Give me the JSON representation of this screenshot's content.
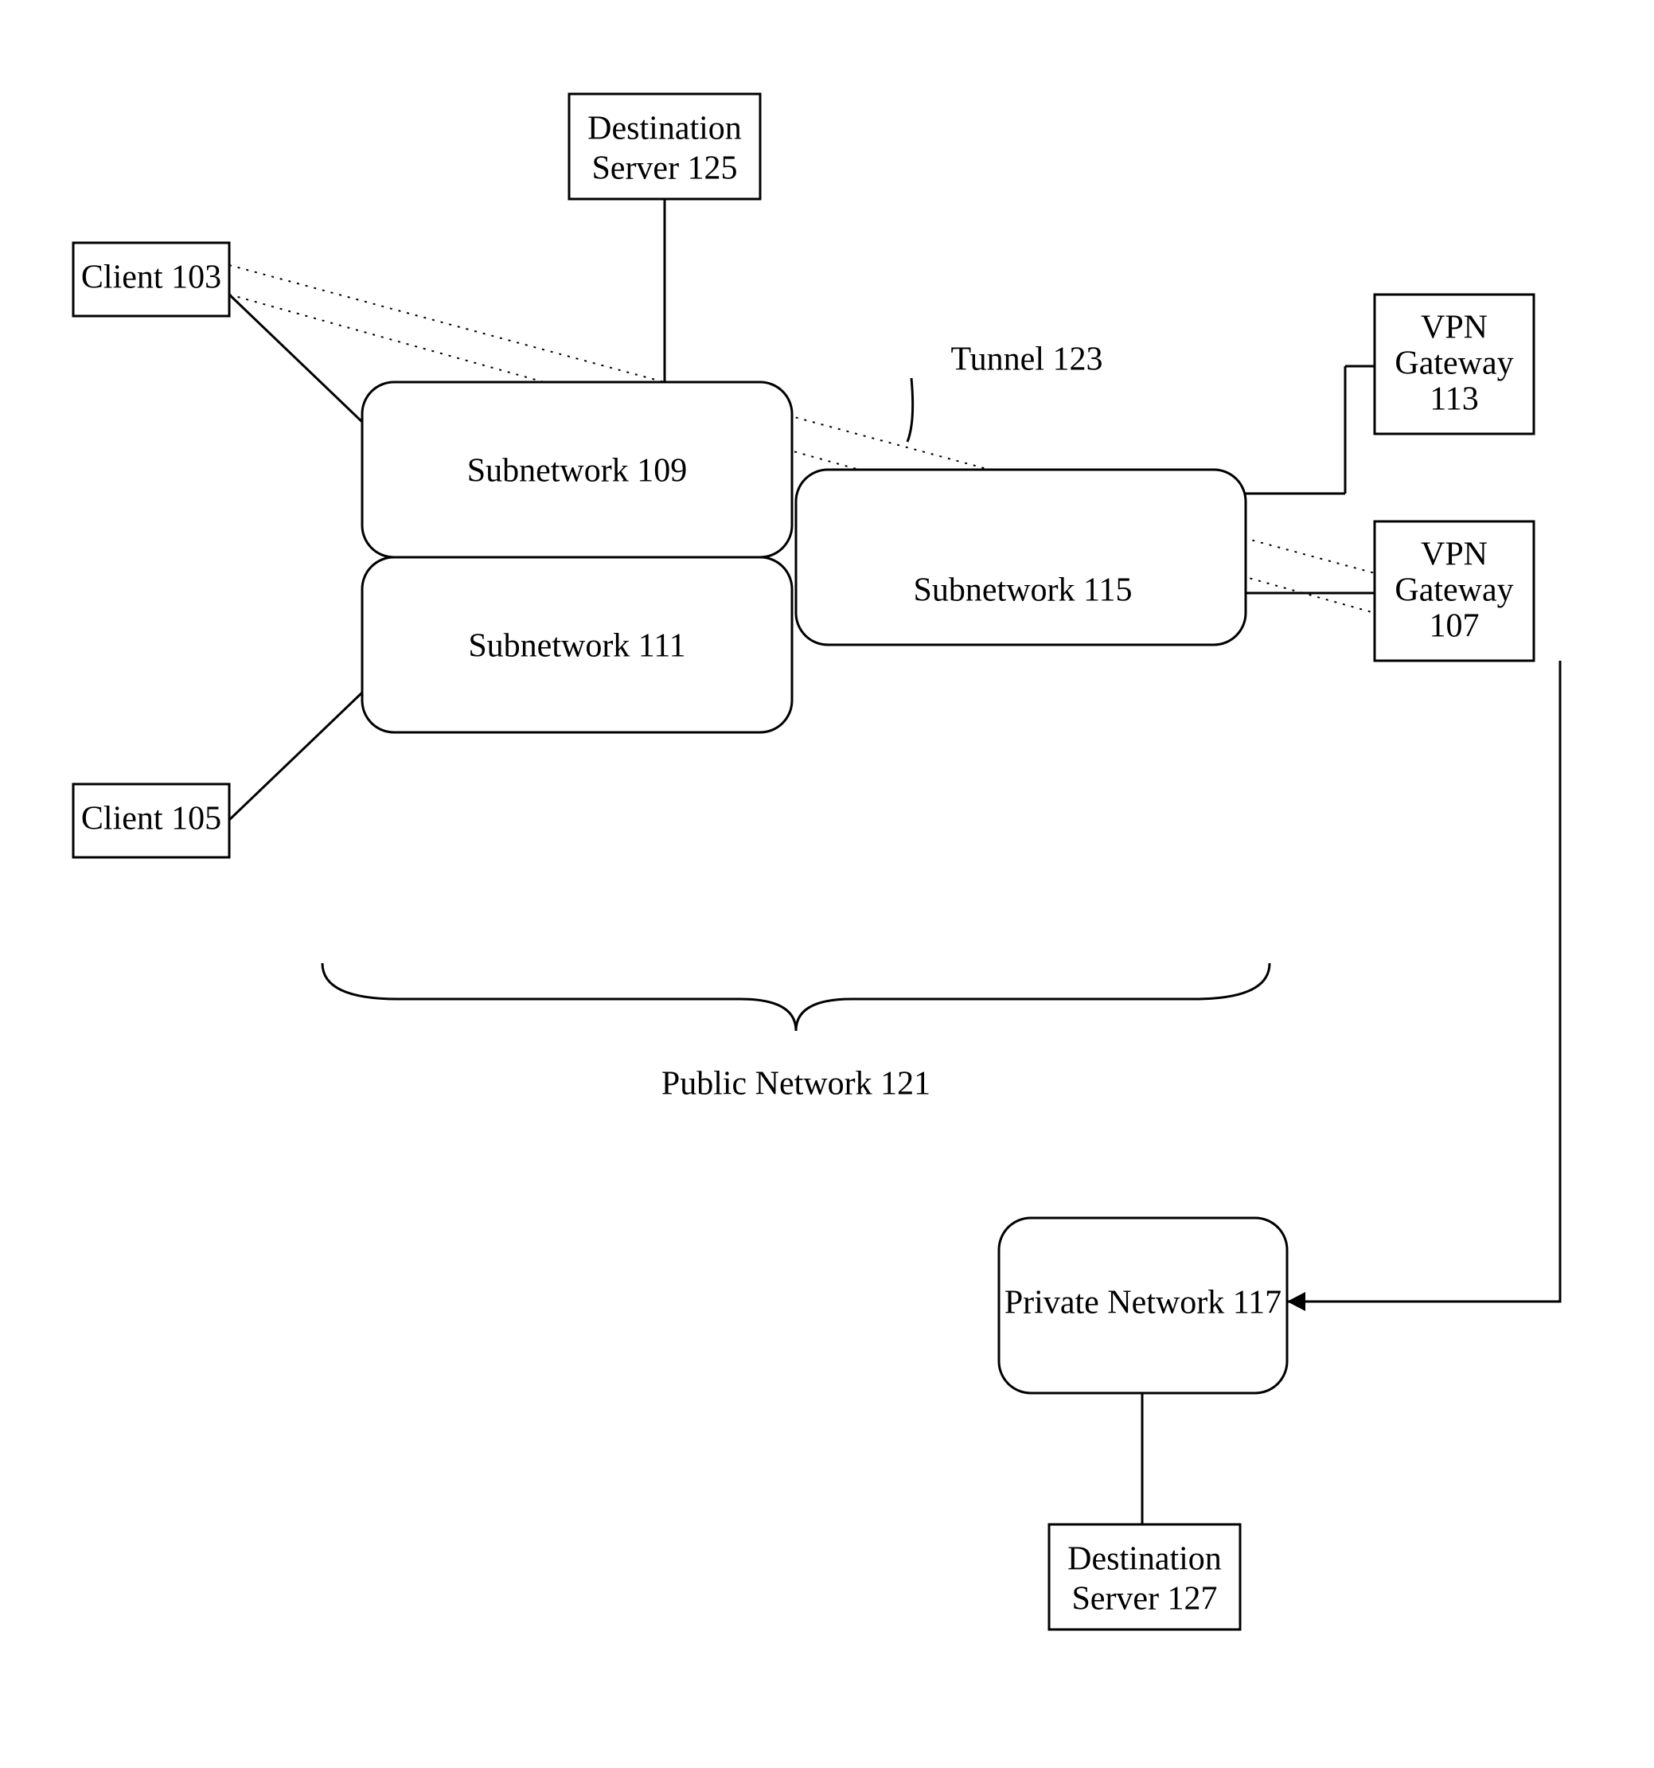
{
  "nodes": {
    "client103": "Client 103",
    "client105": "Client 105",
    "destServer125_line1": "Destination",
    "destServer125_line2": "Server 125",
    "subnet109": "Subnetwork 109",
    "subnet111": "Subnetwork 111",
    "subnet115": "Subnetwork 115",
    "tunnel123": "Tunnel 123",
    "vpn113_line1": "VPN",
    "vpn113_line2": "Gateway",
    "vpn113_line3": "113",
    "vpn107_line1": "VPN",
    "vpn107_line2": "Gateway",
    "vpn107_line3": "107",
    "publicNetwork": "Public Network 121",
    "privateNetwork": "Private Network 117",
    "destServer127_line1": "Destination",
    "destServer127_line2": "Server 127"
  }
}
